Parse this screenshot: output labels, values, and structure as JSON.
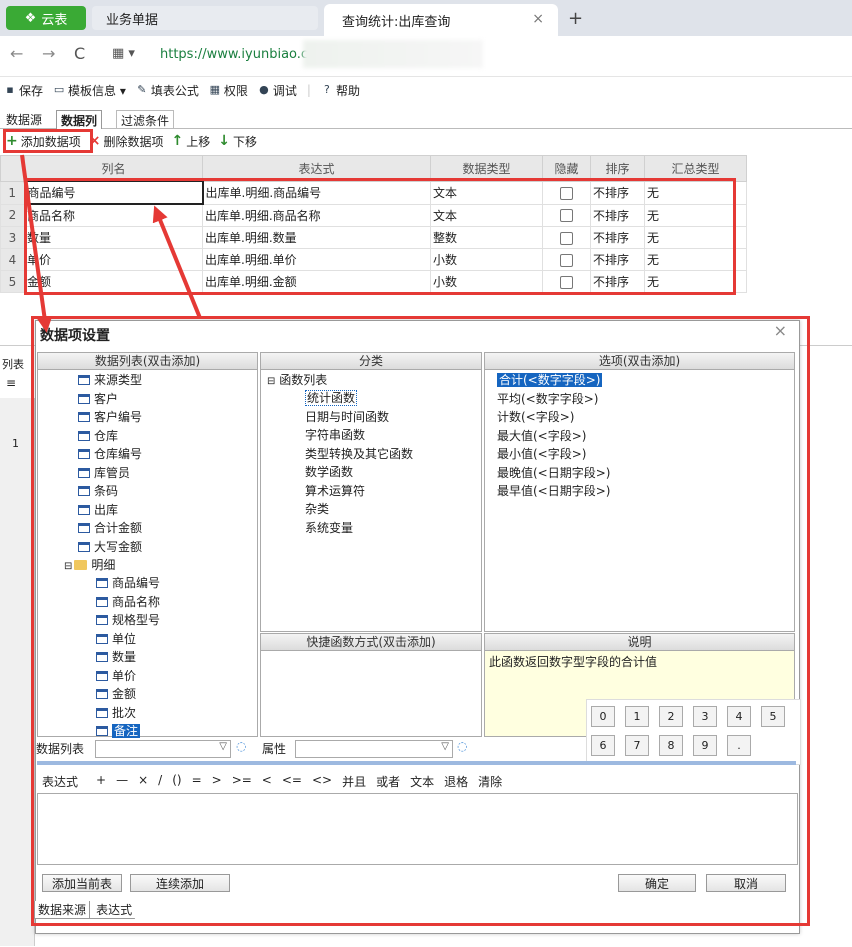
{
  "browser": {
    "logo_label": "云表",
    "tab_biz": "业务单据",
    "tab_active": "查询统计:出库查询",
    "tab_close": "×",
    "tab_plus": "+",
    "nav_back": "←",
    "nav_forward": "→",
    "nav_reload": "C",
    "apps": "▦ ▾",
    "url": "https://www.iyunbiao.cn"
  },
  "toolbar": [
    {
      "icon": "save-icon",
      "glyph": "▪",
      "label": "保存"
    },
    {
      "icon": "template-icon",
      "glyph": "▭",
      "label": "模板信息 ▾"
    },
    {
      "icon": "formula-icon",
      "glyph": "✎",
      "label": "填表公式"
    },
    {
      "icon": "permission-icon",
      "glyph": "▦",
      "label": "权限"
    },
    {
      "icon": "debug-icon",
      "glyph": "●",
      "label": "调试"
    },
    {
      "icon": "help-icon",
      "glyph": "?",
      "label": "帮助"
    }
  ],
  "subtabs": [
    "数据源",
    "数据列",
    "过滤条件"
  ],
  "actions": [
    {
      "glyph": "+",
      "label": "添加数据项",
      "color": "#2e8b2e"
    },
    {
      "glyph": "×",
      "label": "删除数据项",
      "color": "#e53935"
    },
    {
      "glyph": "↑",
      "label": "上移",
      "color": "#2e8b2e"
    },
    {
      "glyph": "↓",
      "label": "下移",
      "color": "#2e8b2e"
    }
  ],
  "grid": {
    "headers": [
      "列名",
      "表达式",
      "数据类型",
      "隐藏",
      "排序",
      "汇总类型"
    ],
    "rows": [
      {
        "num": "1",
        "name": "商品编号",
        "expr": "出库单.明细.商品编号",
        "type": "文本",
        "sort": "不排序",
        "agg": "无"
      },
      {
        "num": "2",
        "name": "商品名称",
        "expr": "出库单.明细.商品名称",
        "type": "文本",
        "sort": "不排序",
        "agg": "无"
      },
      {
        "num": "3",
        "name": "数量",
        "expr": "出库单.明细.数量",
        "type": "整数",
        "sort": "不排序",
        "agg": "无"
      },
      {
        "num": "4",
        "name": "单价",
        "expr": "出库单.明细.单价",
        "type": "小数",
        "sort": "不排序",
        "agg": "无"
      },
      {
        "num": "5",
        "name": "金额",
        "expr": "出库单.明细.金额",
        "type": "小数",
        "sort": "不排序",
        "agg": "无"
      }
    ]
  },
  "behind": {
    "list_label": "列表",
    "row_num": "1"
  },
  "dialog": {
    "title": "数据项设置",
    "close": "×",
    "data_list_header": "数据列表(双击添加)",
    "data_list": [
      "来源类型",
      "客户",
      "客户编号",
      "仓库",
      "仓库编号",
      "库管员",
      "条码",
      "出库",
      "合计金额",
      "大写金额"
    ],
    "detail_folder": "明细",
    "detail_items": [
      "商品编号",
      "商品名称",
      "规格型号",
      "单位",
      "数量",
      "单价",
      "金额",
      "批次",
      "备注"
    ],
    "category_header": "分类",
    "category_root": "函数列表",
    "categories": [
      "统计函数",
      "日期与时间函数",
      "字符串函数",
      "类型转换及其它函数",
      "数学函数",
      "算术运算符",
      "杂类",
      "系统变量"
    ],
    "options_header": "选项(双击添加)",
    "options": [
      "合计(<数字字段>)",
      "平均(<数字字段>)",
      "计数(<字段>)",
      "最大值(<字段>)",
      "最小值(<字段>)",
      "最晚值(<日期字段>)",
      "最早值(<日期字段>)"
    ],
    "shortcut_header": "快捷函数方式(双击添加)",
    "desc_header": "说明",
    "desc_text": "此函数返回数字型字段的合计值",
    "numpad": [
      "0",
      "1",
      "2",
      "3",
      "4",
      "5",
      "6",
      "7",
      "8",
      "9",
      "."
    ],
    "datalist_label": "数据列表",
    "attr_label": "属性",
    "operators": [
      "表达式",
      "+",
      "—",
      "×",
      "/",
      "()",
      "=",
      ">",
      ">=",
      "<",
      "<=",
      "<>",
      "并且",
      "或者",
      "文本",
      "退格",
      "清除"
    ],
    "btn_add_current": "添加当前表",
    "btn_continuous": "连续添加",
    "btn_ok": "确定",
    "btn_cancel": "取消",
    "bottom_tabs": [
      "数据来源",
      "表达式"
    ]
  },
  "accent_red": "#e53935"
}
